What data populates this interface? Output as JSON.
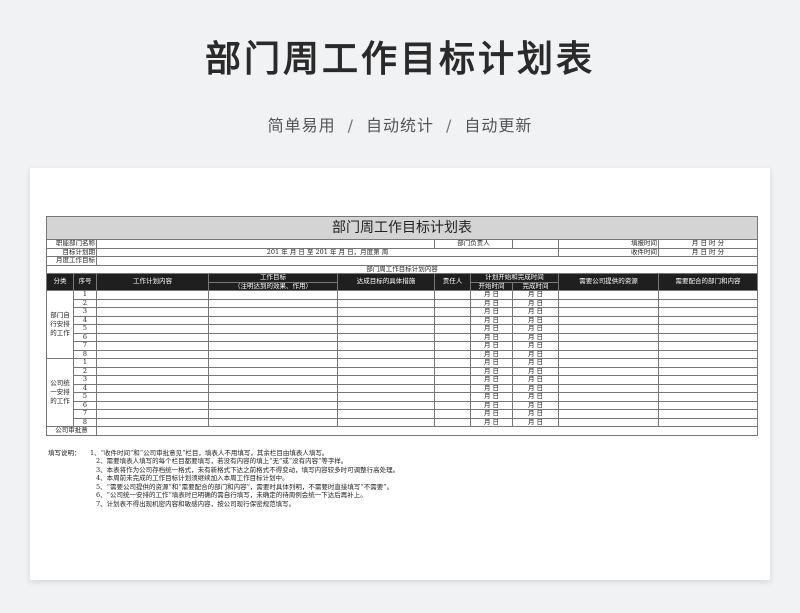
{
  "hero": {
    "title": "部门周工作目标计划表",
    "features": [
      "简单易用",
      "自动统计",
      "自动更新"
    ],
    "separator": "/"
  },
  "form": {
    "title": "部门周工作目标计划表",
    "info": {
      "dept_name_label": "职能部门名称",
      "dept_head_label": "部门负责人",
      "report_time_label": "填报时间",
      "report_time_value": "月  日  时  分",
      "target_period_label": "目标计划期",
      "target_period_value": "201 年  月  日 至 201 年  月  日，月度第  周",
      "receive_time_label": "收件时间",
      "receive_time_value": "月  日  时  分",
      "monthly_target_label": "月度工作目标"
    },
    "section_caption": "部门周工作目标计划内容",
    "headers": {
      "category": "分类",
      "seq": "序号",
      "plan_content": "工作计划内容",
      "work_goal": "工作目标",
      "work_goal_note": "（注明达到的效果、作用）",
      "measures": "达成目标的具体措施",
      "owner": "责任人",
      "plan_time": "计划开始和完成时间",
      "start_time": "开始时间",
      "finish_time": "完成时间",
      "company_resources": "需要公司提供的资源",
      "cooperation": "需要配合的部门和内容"
    },
    "date_placeholder": "月  日",
    "groups": [
      {
        "category": "部门自行安排的工作",
        "rows": [
          "1",
          "2",
          "3",
          "4",
          "5",
          "6",
          "7",
          "8"
        ]
      },
      {
        "category": "公司统一安排的工作",
        "rows": [
          "1",
          "2",
          "3",
          "4",
          "5",
          "6",
          "7",
          "8"
        ]
      }
    ],
    "approval_label": "公司审批意"
  },
  "notes": {
    "label": "填写说明：",
    "items": [
      "1、“收件时间”和“公司审批意见”栏目，填表人不用填写，其余栏目由填表人填写。",
      "2、需要填表人填写的每个栏目都要填写，若没有内容的填上“无”或“没有内容”等字样。",
      "3、本表将作为公司存档统一格式，未有新格式下达之前格式不得变动，填写内容较多时可调整行高处理。",
      "4、本周前未完成的工作目标计划须继续加入本周工作目标计划中。",
      "5、“需要公司提供的资源”和“需要配合的部门和内容”，需要时具体列明，不需要时直接填写“不需要”。",
      "6、“公司统一安排的工作”填表时已明确的需自行填写，未确定的待周例会统一下达后再补上。",
      "7、计划表不得出现机密内容和敏感内容，按公司现行保密规范填写。"
    ]
  }
}
